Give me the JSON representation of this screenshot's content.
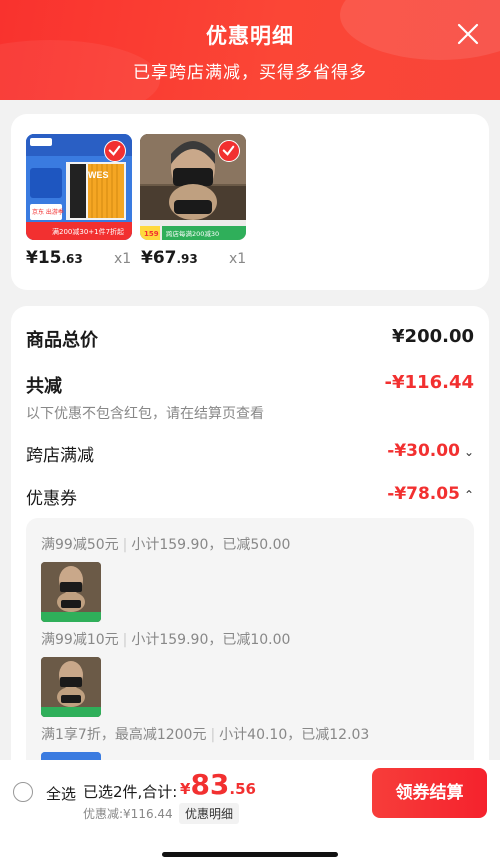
{
  "header": {
    "title": "优惠明细",
    "subtitle": "已享跨店满减，买得多省得多"
  },
  "products": [
    {
      "price_int": "¥15",
      "price_dec": ".63",
      "qty": "x1",
      "checked": true
    },
    {
      "price_int": "¥67",
      "price_dec": ".93",
      "qty": "x1",
      "checked": true
    }
  ],
  "product_art": {
    "filter_brand": "WES",
    "filter_badge": "京东 出游季",
    "filter_promo": "满200减30+1件7折起",
    "mask_price": "159",
    "mask_promo": "跨店每满200减30"
  },
  "detail": {
    "total_label": "商品总价",
    "total_value": "¥200.00",
    "reduce_label": "共减",
    "reduce_value": "-¥116.44",
    "note": "以下优惠不包含红包，请在结算页查看",
    "cross_store_label": "跨店满减",
    "cross_store_value": "-¥30.00",
    "coupon_label": "优惠券",
    "coupon_value": "-¥78.05"
  },
  "coupons": [
    {
      "rule": "满99减50元",
      "detail": "小计159.90，已减50.00"
    },
    {
      "rule": "满99减10元",
      "detail": "小计159.90，已减10.00"
    },
    {
      "rule": "满1享7折，最高减1200元",
      "detail": "小计40.10，已减12.03"
    }
  ],
  "bottom": {
    "select_all": "全选",
    "selected_summary": "已选2件,合计:",
    "total_currency": "¥",
    "total_int": "83",
    "total_dec": ".56",
    "discount_text": "优惠减:¥116.44",
    "detail_link": "优惠明细",
    "checkout_button": "领券结算"
  },
  "colors": {
    "brand_red": "#f23030",
    "header_red": "#f9322e"
  }
}
